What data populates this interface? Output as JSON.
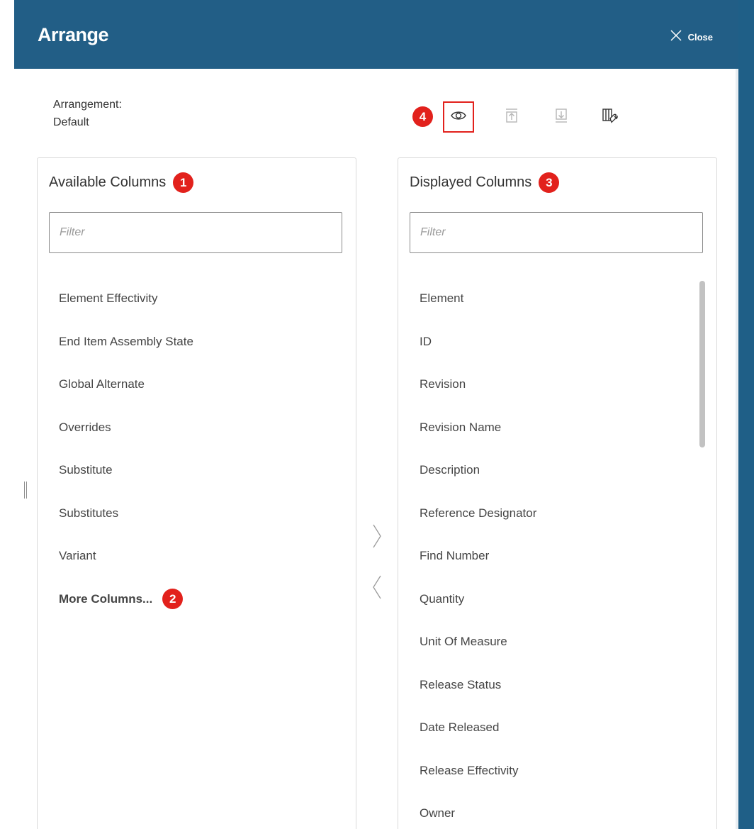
{
  "header": {
    "title": "Arrange",
    "close_label": "Close"
  },
  "arrangement": {
    "label": "Arrangement:",
    "value": "Default"
  },
  "toolbar": {
    "badge": "4",
    "buttons": [
      "eye-icon",
      "move-to-top-icon",
      "move-to-bottom-icon",
      "column-settings-icon"
    ]
  },
  "available": {
    "title": "Available Columns",
    "badge": "1",
    "filter_placeholder": "Filter",
    "items": [
      "Element Effectivity",
      "End Item Assembly State",
      "Global Alternate",
      "Overrides",
      "Substitute",
      "Substitutes",
      "Variant"
    ],
    "more_label": "More Columns...",
    "more_badge": "2"
  },
  "displayed": {
    "title": "Displayed Columns",
    "badge": "3",
    "filter_placeholder": "Filter",
    "items": [
      "Element",
      "ID",
      "Revision",
      "Revision Name",
      "Description",
      "Reference Designator",
      "Find Number",
      "Quantity",
      "Unit Of Measure",
      "Release Status",
      "Date Released",
      "Release Effectivity",
      "Owner"
    ]
  },
  "colors": {
    "header_bg": "#225e86",
    "badge_bg": "#e2211c",
    "link": "#225e86"
  }
}
